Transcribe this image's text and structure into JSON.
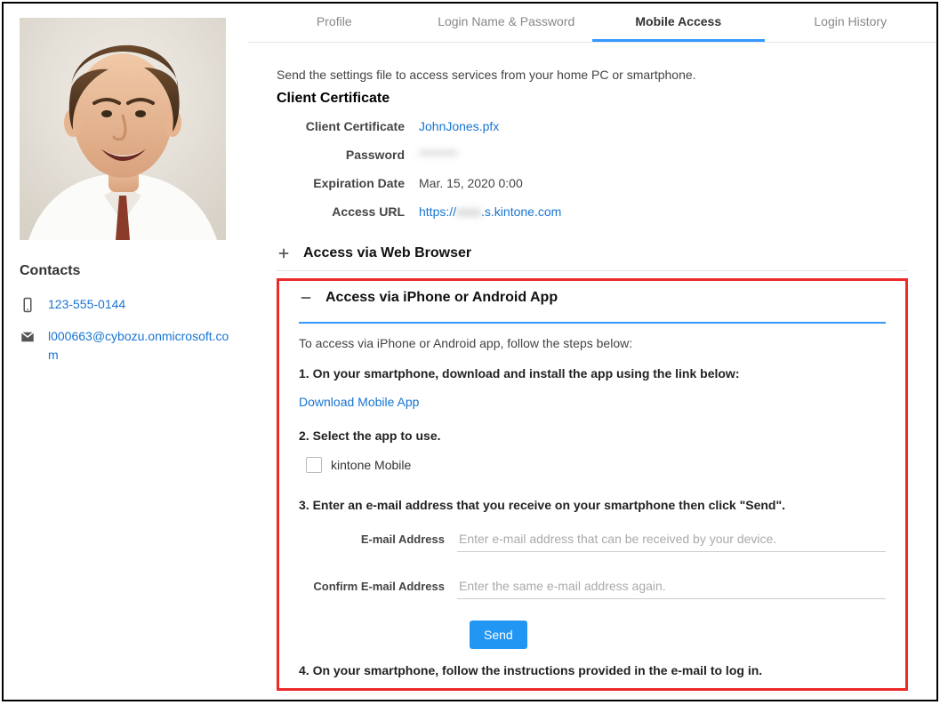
{
  "sidebar": {
    "contacts_heading": "Contacts",
    "phone": "123-555-0144",
    "email": "l000663@cybozu.onmicrosoft.com"
  },
  "tabs": [
    {
      "label": "Profile",
      "active": false
    },
    {
      "label": "Login Name & Password",
      "active": false
    },
    {
      "label": "Mobile Access",
      "active": true
    },
    {
      "label": "Login History",
      "active": false
    }
  ],
  "intro": "Send the settings file to access services from your home PC or smartphone.",
  "cert_section": {
    "title": "Client Certificate",
    "rows": {
      "cert_label": "Client Certificate",
      "cert_file": "JohnJones.pfx",
      "password_label": "Password",
      "password_value": "********",
      "expiration_label": "Expiration Date",
      "expiration_value": "Mar. 15, 2020 0:00",
      "url_label": "Access URL",
      "url_prefix": "https://",
      "url_suffix": ".s.kintone.com",
      "url_hidden": "xxxx"
    }
  },
  "acc_browser": {
    "title": "Access via Web Browser"
  },
  "acc_app": {
    "title": "Access via iPhone or Android App",
    "intro": "To access via iPhone or Android app, follow the steps below:",
    "step1": "1. On your smartphone, download and install the app using the link below:",
    "download_link": "Download Mobile App",
    "step2": "2. Select the app to use.",
    "app_option": "kintone Mobile",
    "step3": "3. Enter an e-mail address that you receive on your smartphone then click \"Send\".",
    "email_label": "E-mail Address",
    "email_placeholder": "Enter e-mail address that can be received by your device.",
    "confirm_label": "Confirm E-mail Address",
    "confirm_placeholder": "Enter the same e-mail address again.",
    "send_label": "Send",
    "step4": "4. On your smartphone, follow the instructions provided in the e-mail to log in."
  }
}
